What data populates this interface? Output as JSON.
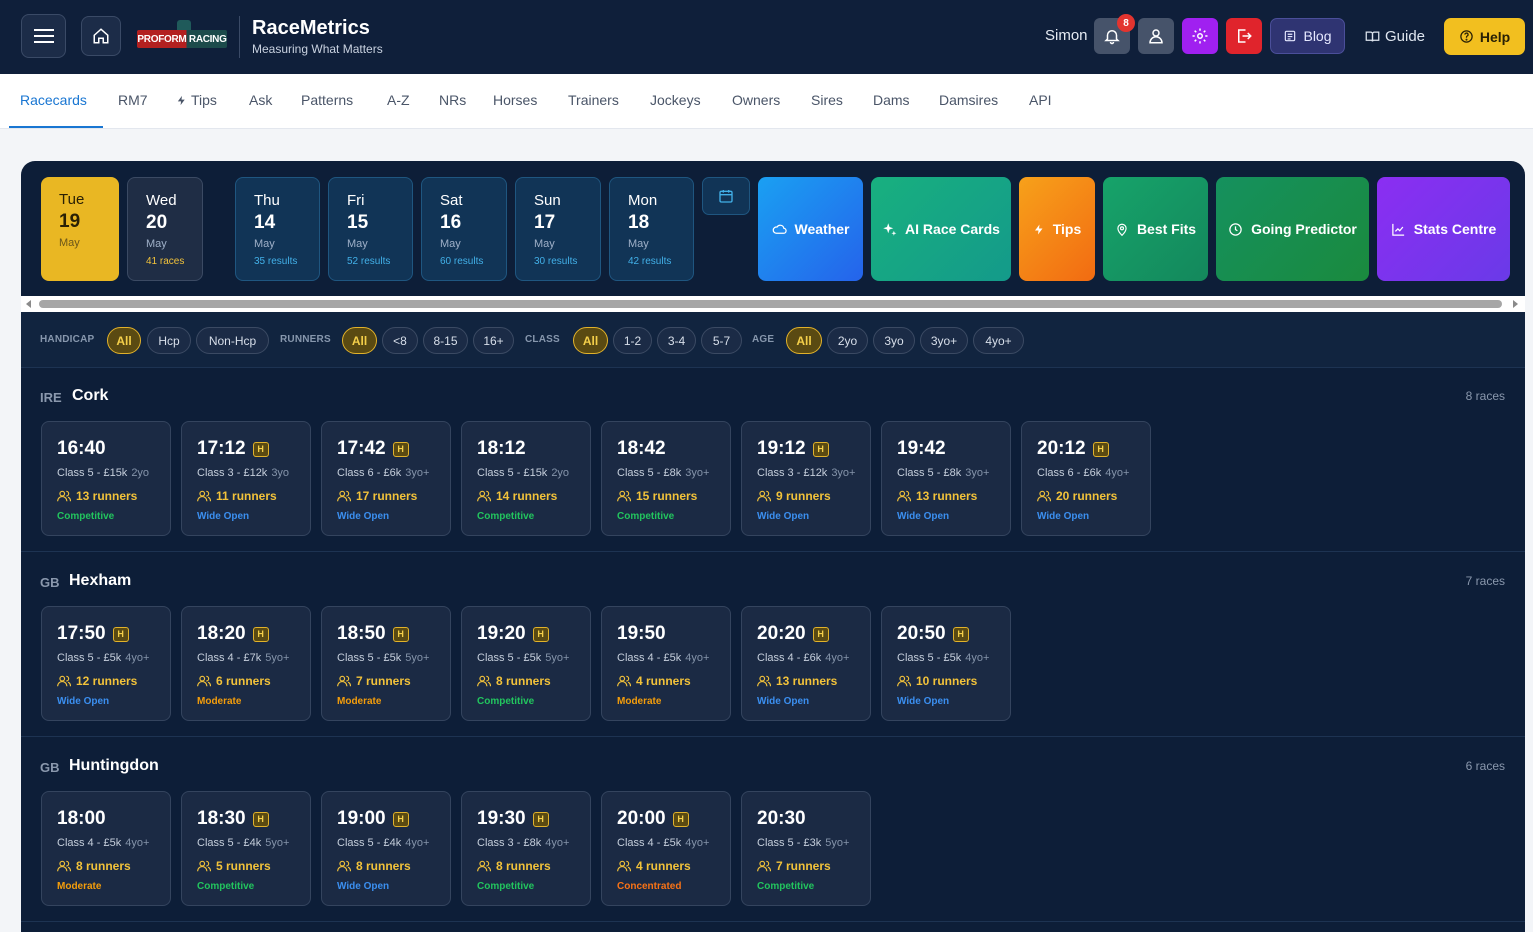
{
  "header": {
    "brand_title": "RaceMetrics",
    "brand_subtitle": "Measuring What Matters",
    "logo_text": "PROFORM RACING",
    "user_name": "Simon",
    "notifications": "8",
    "blog_label": "Blog",
    "guide_label": "Guide",
    "help_label": "Help"
  },
  "nav": {
    "tabs": [
      "Racecards",
      "RM7",
      "Tips",
      "Ask",
      "Patterns",
      "A-Z",
      "NRs",
      "Horses",
      "Trainers",
      "Jockeys",
      "Owners",
      "Sires",
      "Dams",
      "Damsires",
      "API"
    ],
    "active": "Racecards"
  },
  "dates": [
    {
      "dow": "Tue",
      "day": "19",
      "month": "May",
      "count": ""
    },
    {
      "dow": "Wed",
      "day": "20",
      "month": "May",
      "count": "41 races"
    },
    {
      "dow": "Thu",
      "day": "14",
      "month": "May",
      "count": "35 results"
    },
    {
      "dow": "Fri",
      "day": "15",
      "month": "May",
      "count": "52 results"
    },
    {
      "dow": "Sat",
      "day": "16",
      "month": "May",
      "count": "60 results"
    },
    {
      "dow": "Sun",
      "day": "17",
      "month": "May",
      "count": "30 results"
    },
    {
      "dow": "Mon",
      "day": "18",
      "month": "May",
      "count": "42 results"
    }
  ],
  "features": {
    "weather": "Weather",
    "ai": "AI Race Cards",
    "tips": "Tips",
    "fits": "Best Fits",
    "going": "Going Predictor",
    "stats": "Stats Centre"
  },
  "filters": {
    "handicap_label": "HANDICAP",
    "handicap": [
      "All",
      "Hcp",
      "Non-Hcp"
    ],
    "runners_label": "RUNNERS",
    "runners": [
      "All",
      "<8",
      "8-15",
      "16+"
    ],
    "class_label": "CLASS",
    "class": [
      "All",
      "1-2",
      "3-4",
      "5-7"
    ],
    "age_label": "AGE",
    "age": [
      "All",
      "2yo",
      "3yo",
      "3yo+",
      "4yo+"
    ]
  },
  "meetings": [
    {
      "country": "IRE",
      "name": "Cork",
      "count": "8 races",
      "races": [
        {
          "time": "16:40",
          "h": false,
          "cls": "Class 5 - £15k",
          "age": "2yo",
          "runners": "13 runners",
          "comp": "Competitive"
        },
        {
          "time": "17:12",
          "h": true,
          "cls": "Class 3 - £12k",
          "age": "3yo",
          "runners": "11 runners",
          "comp": "Wide Open"
        },
        {
          "time": "17:42",
          "h": true,
          "cls": "Class 6 - £6k",
          "age": "3yo+",
          "runners": "17 runners",
          "comp": "Wide Open"
        },
        {
          "time": "18:12",
          "h": false,
          "cls": "Class 5 - £15k",
          "age": "2yo",
          "runners": "14 runners",
          "comp": "Competitive"
        },
        {
          "time": "18:42",
          "h": false,
          "cls": "Class 5 - £8k",
          "age": "3yo+",
          "runners": "15 runners",
          "comp": "Competitive"
        },
        {
          "time": "19:12",
          "h": true,
          "cls": "Class 3 - £12k",
          "age": "3yo+",
          "runners": "9 runners",
          "comp": "Wide Open"
        },
        {
          "time": "19:42",
          "h": false,
          "cls": "Class 5 - £8k",
          "age": "3yo+",
          "runners": "13 runners",
          "comp": "Wide Open"
        },
        {
          "time": "20:12",
          "h": true,
          "cls": "Class 6 - £6k",
          "age": "4yo+",
          "runners": "20 runners",
          "comp": "Wide Open"
        }
      ]
    },
    {
      "country": "GB",
      "name": "Hexham",
      "count": "7 races",
      "races": [
        {
          "time": "17:50",
          "h": true,
          "cls": "Class 5 - £5k",
          "age": "4yo+",
          "runners": "12 runners",
          "comp": "Wide Open"
        },
        {
          "time": "18:20",
          "h": true,
          "cls": "Class 4 - £7k",
          "age": "5yo+",
          "runners": "6 runners",
          "comp": "Moderate"
        },
        {
          "time": "18:50",
          "h": true,
          "cls": "Class 5 - £5k",
          "age": "5yo+",
          "runners": "7 runners",
          "comp": "Moderate"
        },
        {
          "time": "19:20",
          "h": true,
          "cls": "Class 5 - £5k",
          "age": "5yo+",
          "runners": "8 runners",
          "comp": "Competitive"
        },
        {
          "time": "19:50",
          "h": false,
          "cls": "Class 4 - £5k",
          "age": "4yo+",
          "runners": "4 runners",
          "comp": "Moderate"
        },
        {
          "time": "20:20",
          "h": true,
          "cls": "Class 4 - £6k",
          "age": "4yo+",
          "runners": "13 runners",
          "comp": "Wide Open"
        },
        {
          "time": "20:50",
          "h": true,
          "cls": "Class 5 - £5k",
          "age": "4yo+",
          "runners": "10 runners",
          "comp": "Wide Open"
        }
      ]
    },
    {
      "country": "GB",
      "name": "Huntingdon",
      "count": "6 races",
      "races": [
        {
          "time": "18:00",
          "h": false,
          "cls": "Class 4 - £5k",
          "age": "4yo+",
          "runners": "8 runners",
          "comp": "Moderate"
        },
        {
          "time": "18:30",
          "h": true,
          "cls": "Class 5 - £4k",
          "age": "5yo+",
          "runners": "5 runners",
          "comp": "Competitive"
        },
        {
          "time": "19:00",
          "h": true,
          "cls": "Class 5 - £4k",
          "age": "4yo+",
          "runners": "8 runners",
          "comp": "Wide Open"
        },
        {
          "time": "19:30",
          "h": true,
          "cls": "Class 3 - £8k",
          "age": "4yo+",
          "runners": "8 runners",
          "comp": "Competitive"
        },
        {
          "time": "20:00",
          "h": true,
          "cls": "Class 4 - £5k",
          "age": "4yo+",
          "runners": "4 runners",
          "comp": "Concentrated"
        },
        {
          "time": "20:30",
          "h": false,
          "cls": "Class 5 - £3k",
          "age": "5yo+",
          "runners": "7 runners",
          "comp": "Competitive"
        }
      ]
    }
  ]
}
